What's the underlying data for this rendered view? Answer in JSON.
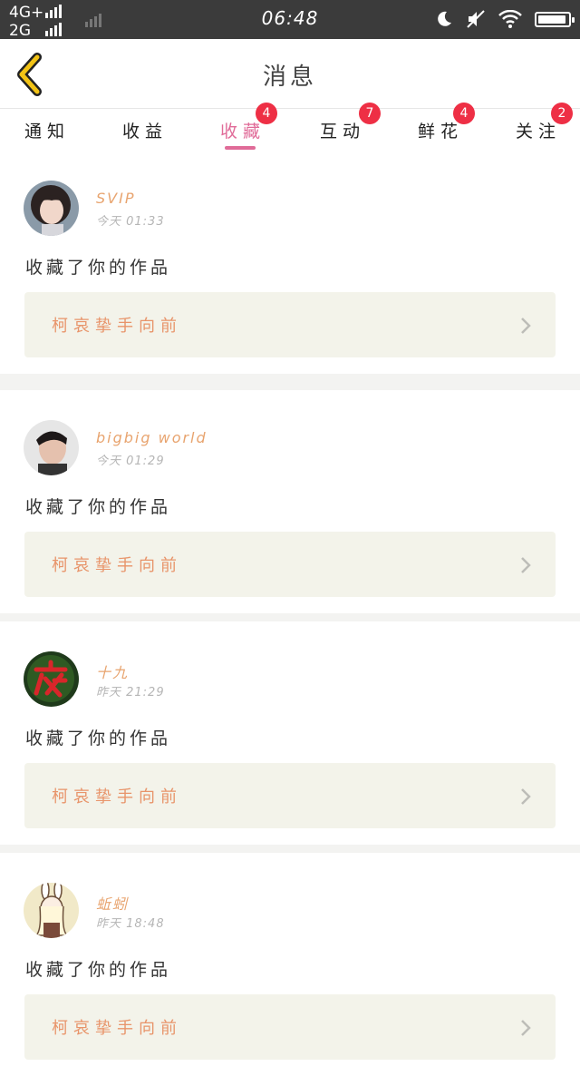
{
  "status_bar": {
    "net_1": "4G+",
    "net_2": "2G",
    "time": "06:48",
    "icons": [
      "signal-bars-icon",
      "moon-icon",
      "mute-icon",
      "wifi-icon",
      "battery-icon"
    ],
    "battery_level": 0.95
  },
  "header": {
    "title": "消息",
    "back_icon": "chevron-left-icon"
  },
  "tabs": [
    {
      "label": "通知",
      "badge": ""
    },
    {
      "label": "收益",
      "badge": ""
    },
    {
      "label": "收藏",
      "badge": "4",
      "active": true
    },
    {
      "label": "互动",
      "badge": "7"
    },
    {
      "label": "鲜花",
      "badge": "4"
    },
    {
      "label": "关注",
      "badge": "2"
    }
  ],
  "notifications": [
    {
      "name": "SVIP",
      "time": "今天  01:33",
      "action": "收藏了你的作品",
      "work": "柯哀挚手向前",
      "avatar": "girl-photo"
    },
    {
      "name": "bigbig world",
      "time": "今天  01:29",
      "action": "收藏了你的作品",
      "work": "柯哀挚手向前",
      "avatar": "boy-photo"
    },
    {
      "name": "十九",
      "time": "昨天  21:29",
      "action": "收藏了你的作品",
      "work": "柯哀挚手向前",
      "avatar": "night-calligraphy"
    },
    {
      "name": "蚯蚓",
      "time": "昨天  18:48",
      "action": "收藏了你的作品",
      "work": "柯哀挚手向前",
      "avatar": "bunny-girl-drawing"
    }
  ],
  "colors": {
    "accent": "#e06b98",
    "badge": "#ee2f45",
    "username": "#e8a46f",
    "work_title": "#e8946a",
    "back_arrow": "#f2c315"
  }
}
